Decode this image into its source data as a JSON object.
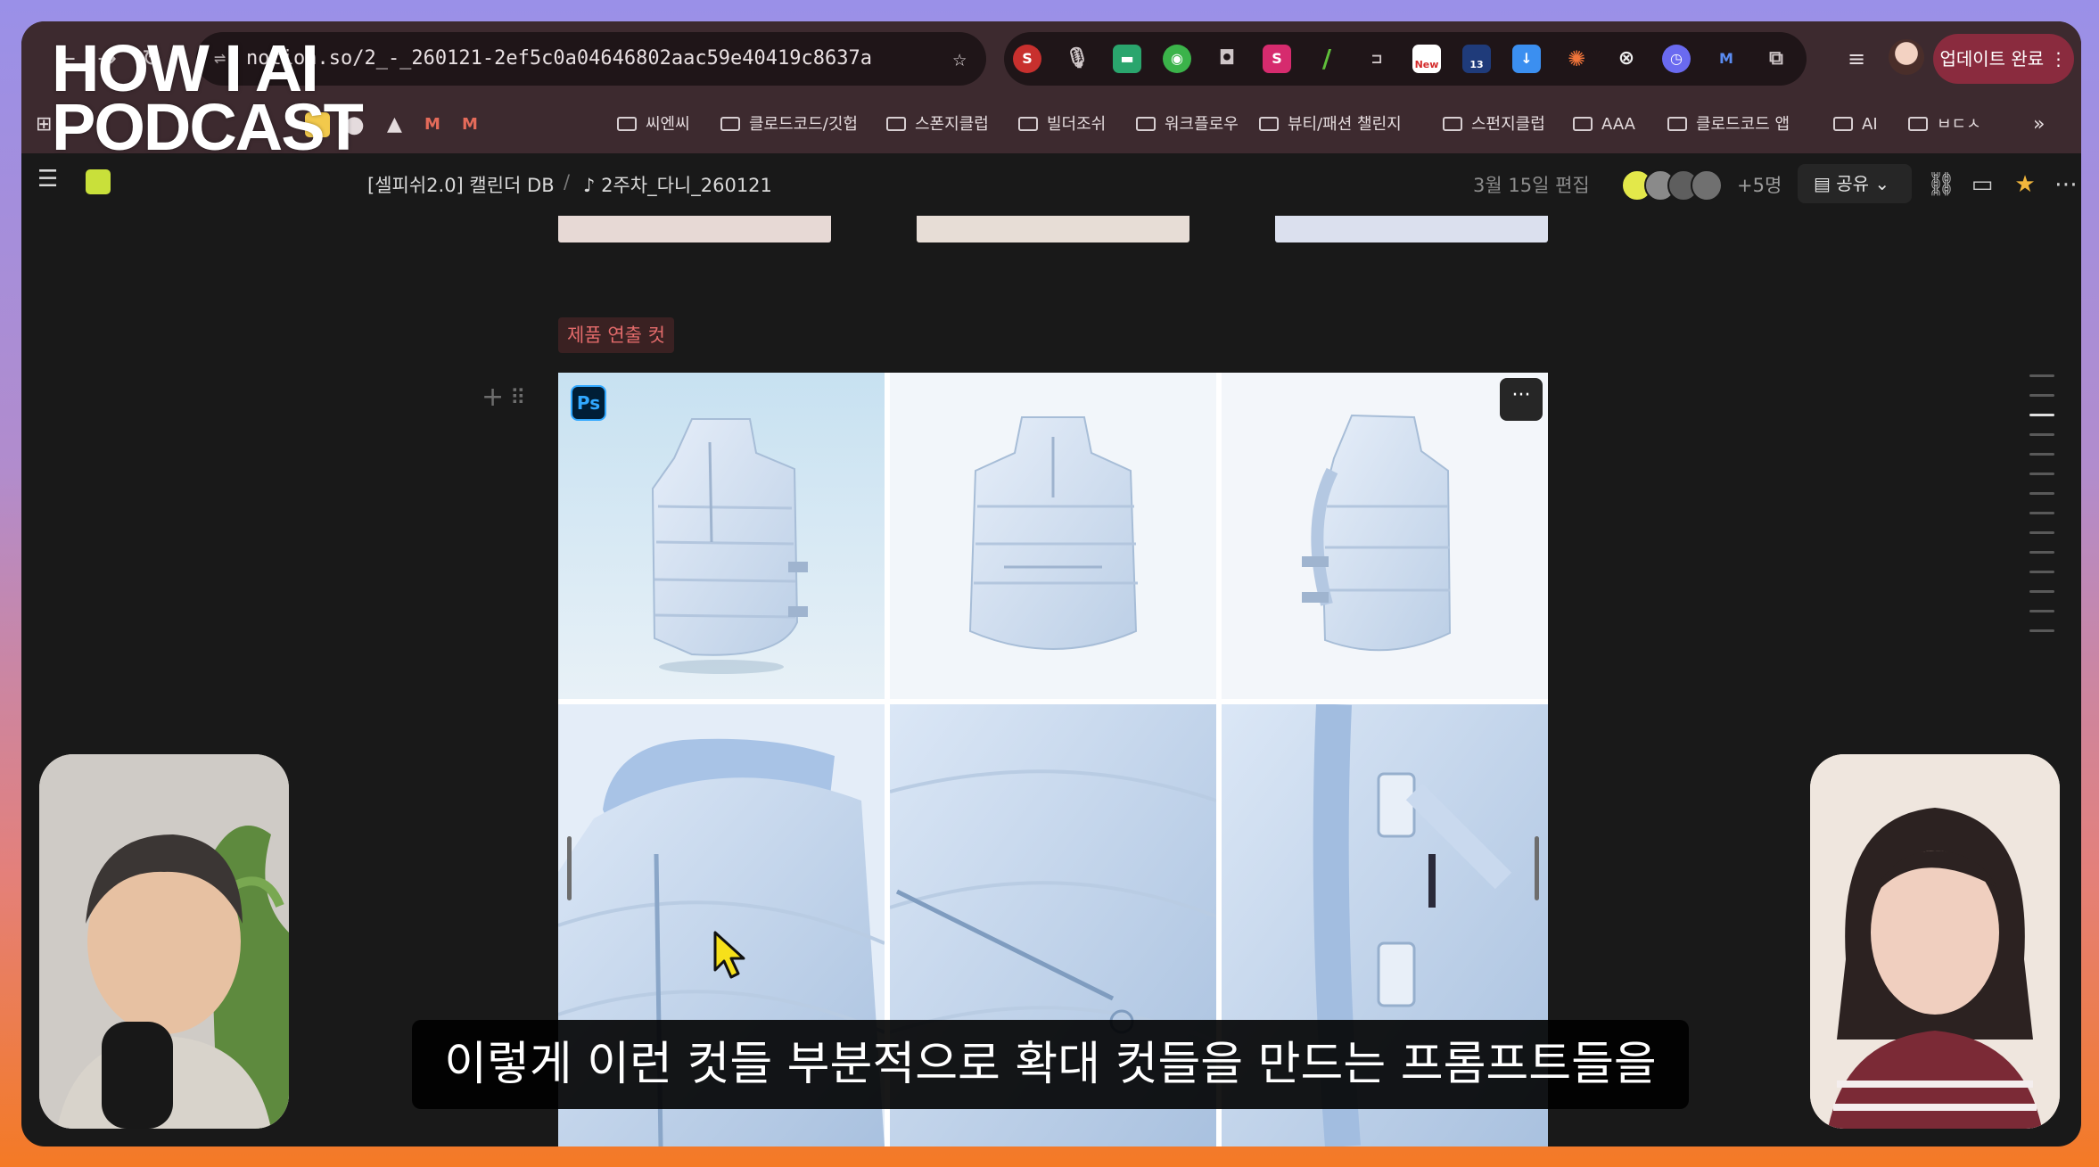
{
  "overlay": {
    "logo_line1": "HOW I AI",
    "logo_line2": "PODCAST",
    "subtitle": "이렇게 이런 컷들 부분적으로 확대 컷들을 만드는 프롬프트들을"
  },
  "browser": {
    "url": "notion.so/2_-_260121-2ef5c0a04646802aac59e40419c8637a",
    "update_button": "업데이트 완료",
    "bookmarks": [
      "씨엔씨",
      "클로드코드/깃헙",
      "스폰지클럽",
      "빌더조쉬",
      "워크플로우",
      "뷰티/패션 챌린지",
      "스펀지클럽",
      "AAA",
      "클로드코드 앱",
      "AI",
      "ㅂㄷㅅ"
    ],
    "ext_badges": {
      "new": "New",
      "thirteen": "13"
    }
  },
  "notion": {
    "breadcrumb_db": "[셀피쉬2.0] 캘린더 DB",
    "breadcrumb_sep": "/",
    "breadcrumb_page": "2주차_다니_260121",
    "edited": "3월 15일 편집",
    "more_users": "+5명",
    "share_label": "공유",
    "section_tag": "제품 연출 컷",
    "ps_badge": "Ps",
    "more_dots": "···",
    "gallery_alt": "R-X 라이트블루 패딩 베스트"
  },
  "colors": {
    "frame_bg": "#191919",
    "browser_bar": "#3d2a2f",
    "tag_text": "#e36b6b",
    "product": "#cfe0f5"
  }
}
